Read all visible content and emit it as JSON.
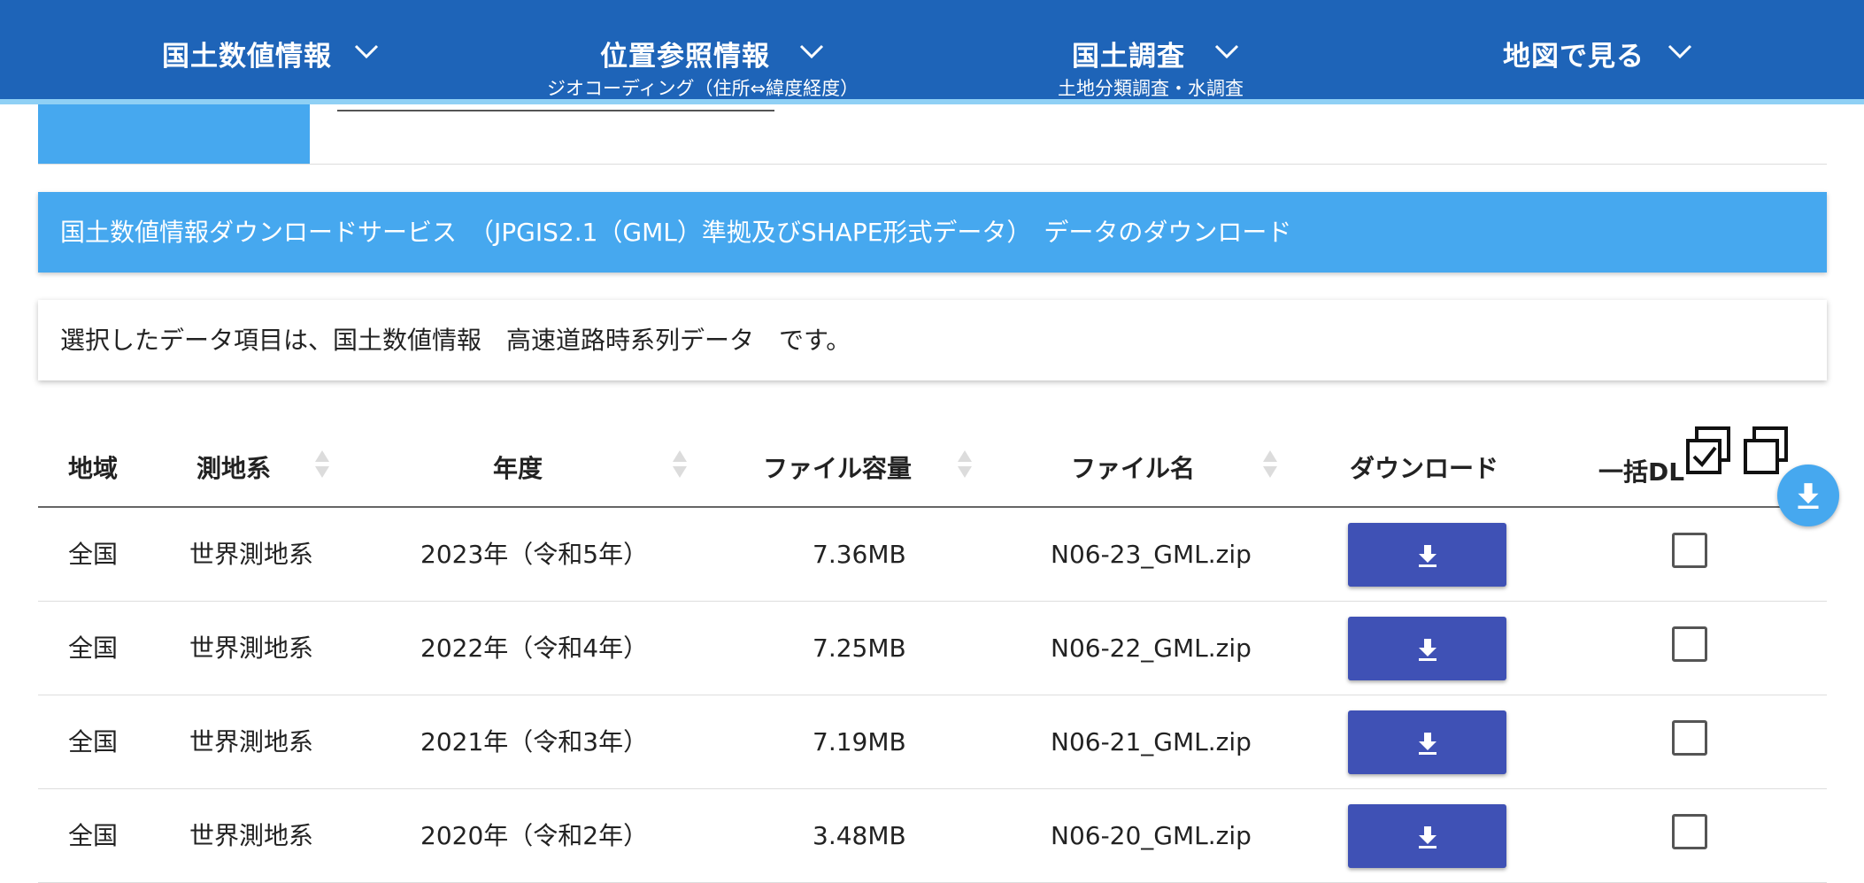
{
  "nav": {
    "items": [
      {
        "label": "国土数値情報",
        "sub": ""
      },
      {
        "label": "位置参照情報",
        "sub": "ジオコーディング（住所⇔緯度経度）"
      },
      {
        "label": "国土調査",
        "sub": "土地分類調査・水調査"
      },
      {
        "label": "地図で見る",
        "sub": ""
      }
    ]
  },
  "banner": {
    "text": "国土数値情報ダウンロードサービス　（JPGIS2.1（GML）準拠及びSHAPE形式データ）　データのダウンロード"
  },
  "info": {
    "text": "選択したデータ項目は、国土数値情報　高速道路時系列データ　です。"
  },
  "table": {
    "headers": {
      "region": "地域",
      "datum": "測地系",
      "year": "年度",
      "size": "ファイル容量",
      "filename": "ファイル名",
      "download": "ダウンロード",
      "bulk": "一括DL"
    },
    "rows": [
      {
        "region": "全国",
        "datum": "世界測地系",
        "year": "2023年（令和5年）",
        "size": "7.36MB",
        "filename": "N06-23_GML.zip"
      },
      {
        "region": "全国",
        "datum": "世界測地系",
        "year": "2022年（令和4年）",
        "size": "7.25MB",
        "filename": "N06-22_GML.zip"
      },
      {
        "region": "全国",
        "datum": "世界測地系",
        "year": "2021年（令和3年）",
        "size": "7.19MB",
        "filename": "N06-21_GML.zip"
      },
      {
        "region": "全国",
        "datum": "世界測地系",
        "year": "2020年（令和2年）",
        "size": "3.48MB",
        "filename": "N06-20_GML.zip"
      }
    ]
  },
  "icons": {
    "nav_chevron": "chevron-down-icon",
    "download": "download-icon",
    "select_all": "check-all-icon",
    "deselect_all": "uncheck-all-icon",
    "bulk_download": "download-fab-icon"
  },
  "colors": {
    "nav_bg": "#1e64b8",
    "accent": "#46a8ef",
    "button": "#3f51b5"
  }
}
